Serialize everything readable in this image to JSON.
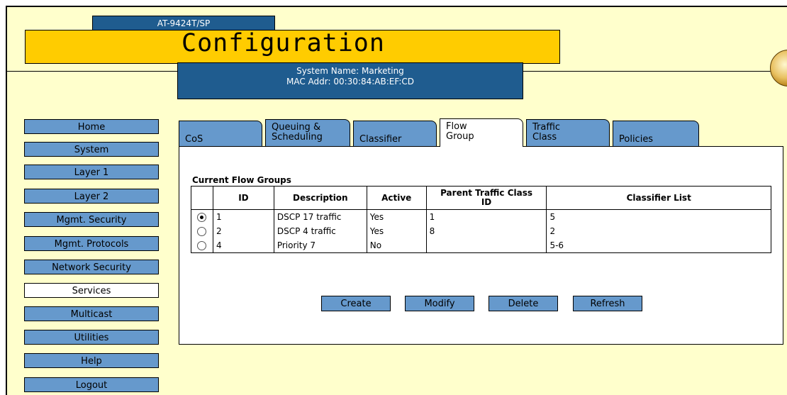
{
  "header": {
    "model": "AT-9424T/SP",
    "title": "Configuration",
    "system_name": "System Name: Marketing",
    "mac_addr": "MAC Addr: 00:30:84:AB:EF:CD"
  },
  "nav": [
    {
      "label": "Home"
    },
    {
      "label": "System"
    },
    {
      "label": "Layer 1"
    },
    {
      "label": "Layer 2"
    },
    {
      "label": "Mgmt. Security"
    },
    {
      "label": "Mgmt. Protocols"
    },
    {
      "label": "Network Security"
    },
    {
      "label": "Services",
      "active": true
    },
    {
      "label": "Multicast"
    },
    {
      "label": "Utilities"
    },
    {
      "label": "Help"
    },
    {
      "label": "Logout"
    }
  ],
  "tabs": {
    "cos": "CoS",
    "queuing_1": "Queuing &",
    "queuing_2": "Scheduling",
    "classifier": "Classifier",
    "flow_1": "Flow",
    "flow_2": "Group",
    "traffic_1": "Traffic",
    "traffic_2": "Class",
    "policies": "Policies"
  },
  "content": {
    "section_title": "Current Flow Groups",
    "headers": {
      "id": "ID",
      "description": "Description",
      "active": "Active",
      "parent_1": "Parent Traffic Class",
      "parent_2": "ID",
      "classifier_list": "Classifier List"
    },
    "rows": [
      {
        "selected": true,
        "id": "1",
        "description": "DSCP 17 traffic",
        "active": "Yes",
        "parent": "1",
        "classifiers": "5"
      },
      {
        "selected": false,
        "id": "2",
        "description": "DSCP 4 traffic",
        "active": "Yes",
        "parent": "8",
        "classifiers": "2"
      },
      {
        "selected": false,
        "id": "4",
        "description": "Priority 7",
        "active": "No",
        "parent": "",
        "classifiers": "5-6"
      }
    ],
    "buttons": {
      "create": "Create",
      "modify": "Modify",
      "delete": "Delete",
      "refresh": "Refresh"
    }
  }
}
